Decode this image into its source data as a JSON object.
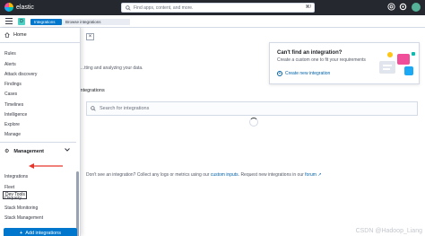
{
  "header": {
    "logo_text": "elastic",
    "search_placeholder": "Find apps, content, and more.",
    "search_shortcut": "⌘/"
  },
  "breadcrumbs": {
    "space_initial": "D",
    "items": [
      "Integrations",
      "Browse integrations"
    ]
  },
  "main": {
    "description": "...tting and analyzing your data.",
    "integrations_heading": "Integrations",
    "search_placeholder": "Search for integrations",
    "footer": {
      "prefix": "Don't see an integration? Collect any logs or metrics using our ",
      "custom_inputs_link": "custom inputs",
      "middle": ". Request new integrations in our ",
      "forum_link": "forum"
    },
    "card": {
      "title": "Can't find an integration?",
      "subtitle": "Create a custom one to fit your requirements",
      "link": "Create new integration"
    }
  },
  "nav": {
    "home": "Home",
    "items": [
      "Rules",
      "Alerts",
      "Attack discovery",
      "Findings",
      "Cases",
      "Timelines",
      "Intelligence",
      "Explore",
      "Manage"
    ],
    "management": {
      "title": "Management",
      "items": [
        "Dev Tools",
        "Integrations",
        "Fleet",
        "Osquery",
        "Stack Monitoring",
        "Stack Management"
      ]
    },
    "add_button": "Add integrations"
  },
  "watermark": "CSDN @Hadoop_Liang",
  "colors": {
    "header_bg": "#25282f",
    "primary": "#0077cc",
    "arrow": "#e7352b"
  }
}
